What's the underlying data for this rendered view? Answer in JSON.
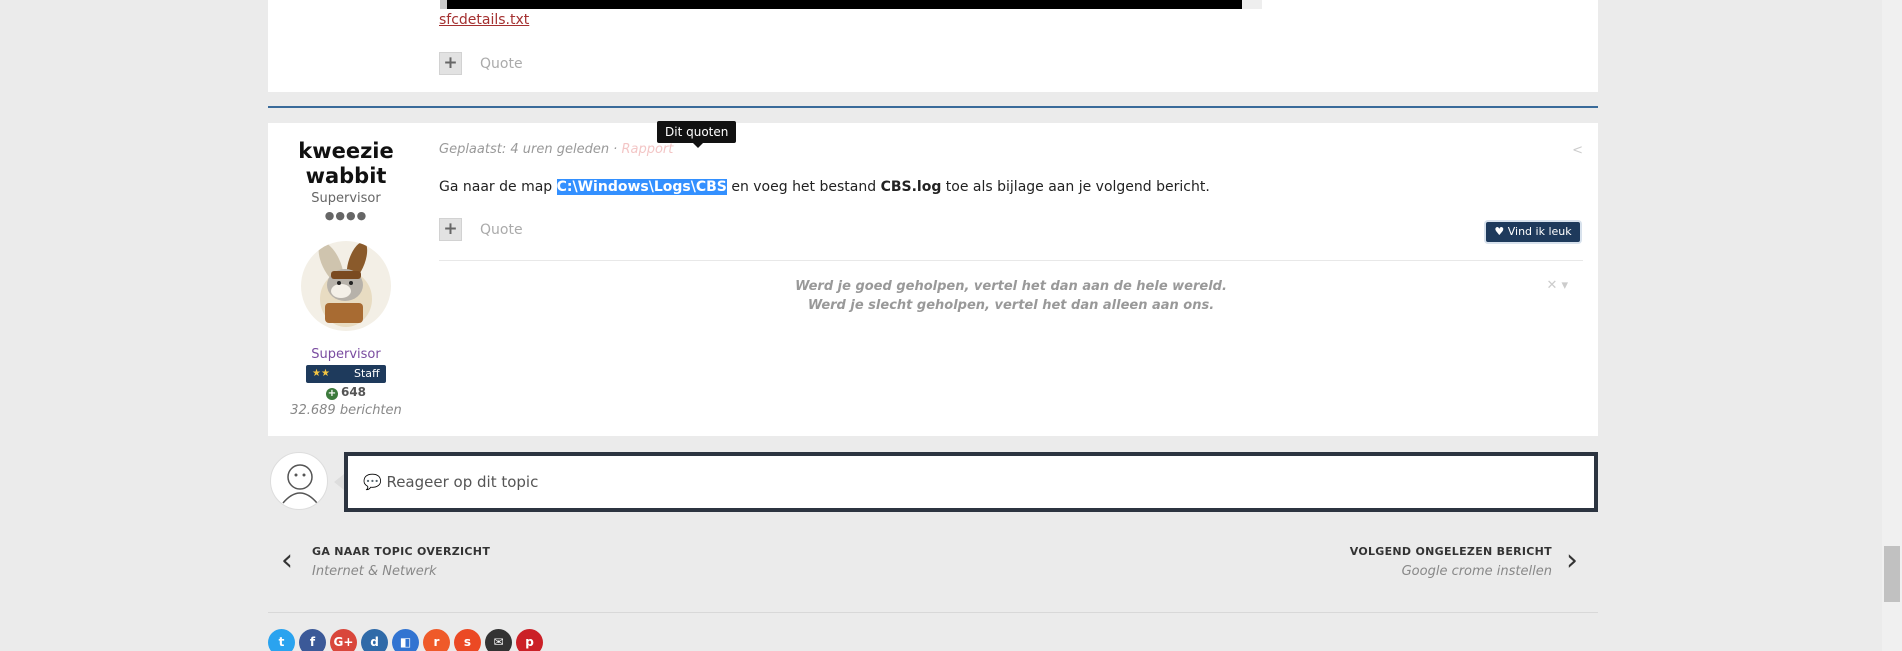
{
  "previous_post": {
    "attachment": "sfcdetails.txt",
    "quote_label": "Quote",
    "add_label": "+"
  },
  "post": {
    "author": {
      "name": "kweezie wabbit",
      "title": "Supervisor",
      "pips": "●●●●",
      "group": "Supervisor",
      "badge_stars": "★★",
      "badge_label": "Staff",
      "reputation": "648",
      "post_count": "32.689 berichten"
    },
    "meta": {
      "posted": "Geplaatst: 4 uren geleden · ",
      "report": "Rapport"
    },
    "tooltip": "Dit quoten",
    "content": {
      "before": "Ga naar de map ",
      "selected": "C:\\Windows\\Logs\\CBS",
      "middle": " en voeg het bestand ",
      "file": "CBS.log",
      "after": " toe als bijlage aan je volgend bericht."
    },
    "quote_label": "Quote",
    "add_label": "+",
    "like_label": "Vind ik leuk",
    "signature": {
      "line1": "Werd je goed geholpen, vertel het dan aan de hele wereld.",
      "line2": "Werd je slecht geholpen, vertel het dan alleen aan ons."
    }
  },
  "reply": {
    "placeholder": "Reageer op dit topic"
  },
  "navigation": {
    "prev": {
      "heading": "GA NAAR TOPIC OVERZICHT",
      "sub": "Internet & Netwerk"
    },
    "next": {
      "heading": "VOLGEND ONGELEZEN BERICHT",
      "sub": "Google crome instellen"
    }
  },
  "share": [
    {
      "icon": "twitter-icon",
      "glyph": "t",
      "color": "#2aa3ef"
    },
    {
      "icon": "facebook-icon",
      "glyph": "f",
      "color": "#3b5998"
    },
    {
      "icon": "googleplus-icon",
      "glyph": "G+",
      "color": "#d9473b"
    },
    {
      "icon": "digg-icon",
      "glyph": "d",
      "color": "#2f6aa8"
    },
    {
      "icon": "delicious-icon",
      "glyph": "◧",
      "color": "#3274d1"
    },
    {
      "icon": "reddit-icon",
      "glyph": "r",
      "color": "#ef5a29"
    },
    {
      "icon": "stumbleupon-icon",
      "glyph": "s",
      "color": "#eb4924"
    },
    {
      "icon": "email-icon",
      "glyph": "✉",
      "color": "#333333"
    },
    {
      "icon": "pinterest-icon",
      "glyph": "p",
      "color": "#cb2027"
    }
  ],
  "colors": {
    "accent": "#3a6b9a",
    "badge": "#1e3a5c",
    "selection": "#3390ff"
  }
}
